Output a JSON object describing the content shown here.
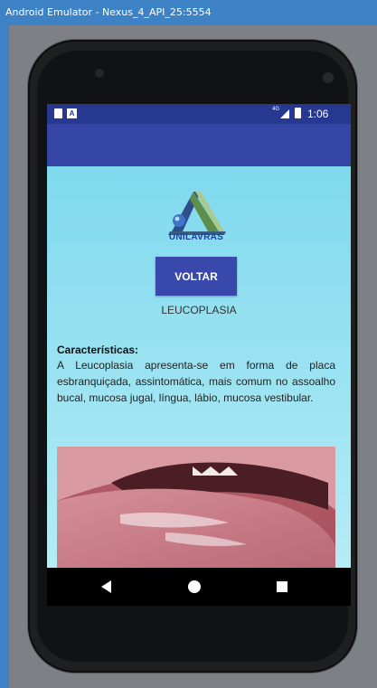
{
  "window": {
    "title": "Android Emulator - Nexus_4_API_25:5554"
  },
  "status_bar": {
    "network_label": "4G",
    "time": "1:06",
    "notification_letter": "A"
  },
  "app": {
    "logo_text": "UNILAVRAS",
    "back_button_label": "VOLTAR",
    "page_title": "LEUCOPLASIA",
    "characteristics_label": "Características:",
    "characteristics_text": "A Leucoplasia apresenta-se em forma de placa esbranquiçada, assintomática, mais comum no assoalho bucal, mucosa jugal, língua, lábio, mucosa vestibular."
  },
  "colors": {
    "status_bar": "#26388f",
    "app_bar": "#3445a5",
    "button": "#3949ab",
    "background_top": "#7fd9ee",
    "background_bottom": "#b5ecf5"
  }
}
